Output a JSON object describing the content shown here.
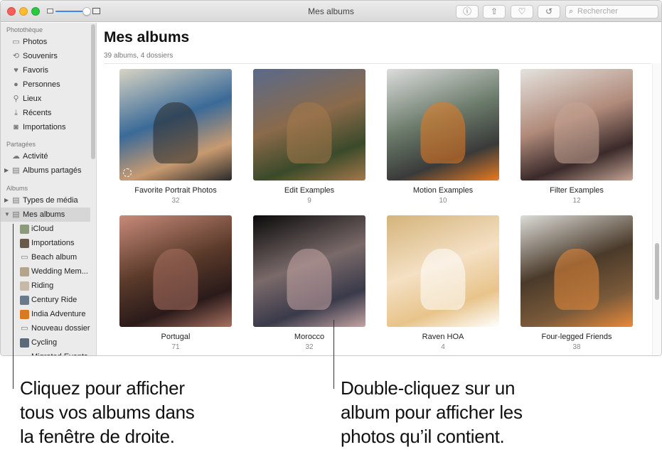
{
  "window": {
    "title": "Mes albums"
  },
  "toolbar": {
    "buttons": [
      {
        "name": "info",
        "glyph": "ⓘ"
      },
      {
        "name": "share",
        "glyph": "⇧"
      },
      {
        "name": "favorite",
        "glyph": "♡"
      },
      {
        "name": "rotate",
        "glyph": "↺"
      }
    ],
    "search_placeholder": "Rechercher",
    "search_glyph": "⌕"
  },
  "sidebar": {
    "sections": [
      {
        "label": "Photothèque"
      },
      {
        "label": "Partagées"
      },
      {
        "label": "Albums"
      }
    ],
    "library": [
      {
        "label": "Photos",
        "icon": "▭"
      },
      {
        "label": "Souvenirs",
        "icon": "⟲"
      },
      {
        "label": "Favoris",
        "icon": "♥"
      },
      {
        "label": "Personnes",
        "icon": "●"
      },
      {
        "label": "Lieux",
        "icon": "⚲"
      },
      {
        "label": "Récents",
        "icon": "⤓"
      },
      {
        "label": "Importations",
        "icon": "◙"
      }
    ],
    "shared": [
      {
        "label": "Activité",
        "icon": "☁"
      },
      {
        "label": "Albums partagés",
        "icon": "▤",
        "disclosure": "▶"
      }
    ],
    "albums": [
      {
        "label": "Types de média",
        "icon": "▤",
        "disclosure": "▶"
      },
      {
        "label": "Mes albums",
        "icon": "▤",
        "disclosure": "▼",
        "selected": true
      }
    ],
    "my_albums": [
      {
        "label": "iCloud",
        "thumb": "#8a9a7a"
      },
      {
        "label": "Importations",
        "thumb": "#6a5a4a"
      },
      {
        "label": "Beach album",
        "thumb": "folder"
      },
      {
        "label": "Wedding Mem...",
        "thumb": "#b4a48c"
      },
      {
        "label": "Riding",
        "thumb": "#c8b8a8"
      },
      {
        "label": "Century Ride",
        "thumb": "#6a7a8a"
      },
      {
        "label": "India Adventure",
        "thumb": "#d87a20"
      },
      {
        "label": "Nouveau dossier",
        "thumb": "folder"
      },
      {
        "label": "Cycling",
        "thumb": "#5a6a7a"
      },
      {
        "label": "Migrated Events",
        "thumb": "folder"
      }
    ]
  },
  "main": {
    "title": "Mes albums",
    "subtitle": "39 albums, 4 dossiers",
    "albums": [
      {
        "name": "Favorite Portrait Photos",
        "count": "32",
        "colors": [
          "#d8d4c4",
          "#3a6a98",
          "#c89a70",
          "#2a2a2a"
        ]
      },
      {
        "name": "Edit Examples",
        "count": "9",
        "colors": [
          "#5a6a8a",
          "#8a6a4a",
          "#3a4a2a",
          "#a4784a"
        ]
      },
      {
        "name": "Motion Examples",
        "count": "10",
        "colors": [
          "#dcdcdc",
          "#6a7a6a",
          "#3a3a3a",
          "#e87a20"
        ]
      },
      {
        "name": "Filter Examples",
        "count": "12",
        "colors": [
          "#e4e2de",
          "#b08a7a",
          "#3a2a2a",
          "#c4a494"
        ]
      },
      {
        "name": "Portugal",
        "count": "71",
        "colors": [
          "#c88a7a",
          "#5a3a2a",
          "#2a1a1a",
          "#a87060"
        ]
      },
      {
        "name": "Morocco",
        "count": "32",
        "colors": [
          "#0a0a0a",
          "#7a6a6a",
          "#3a3a4a",
          "#c4a4a4"
        ]
      },
      {
        "name": "Raven HOA",
        "count": "4",
        "colors": [
          "#d4b47a",
          "#f4e0c4",
          "#e8c48a",
          "#fff"
        ]
      },
      {
        "name": "Four-legged Friends",
        "count": "38",
        "colors": [
          "#dcdcd8",
          "#4a3a2a",
          "#7a5a3a",
          "#e88a3a"
        ]
      }
    ]
  },
  "callouts": [
    {
      "lines": [
        "Cliquez pour afficher",
        "tous vos albums dans",
        "la fenêtre de droite."
      ]
    },
    {
      "lines": [
        "Double-cliquez sur un",
        "album pour afficher les",
        "photos qu’il contient."
      ]
    }
  ]
}
